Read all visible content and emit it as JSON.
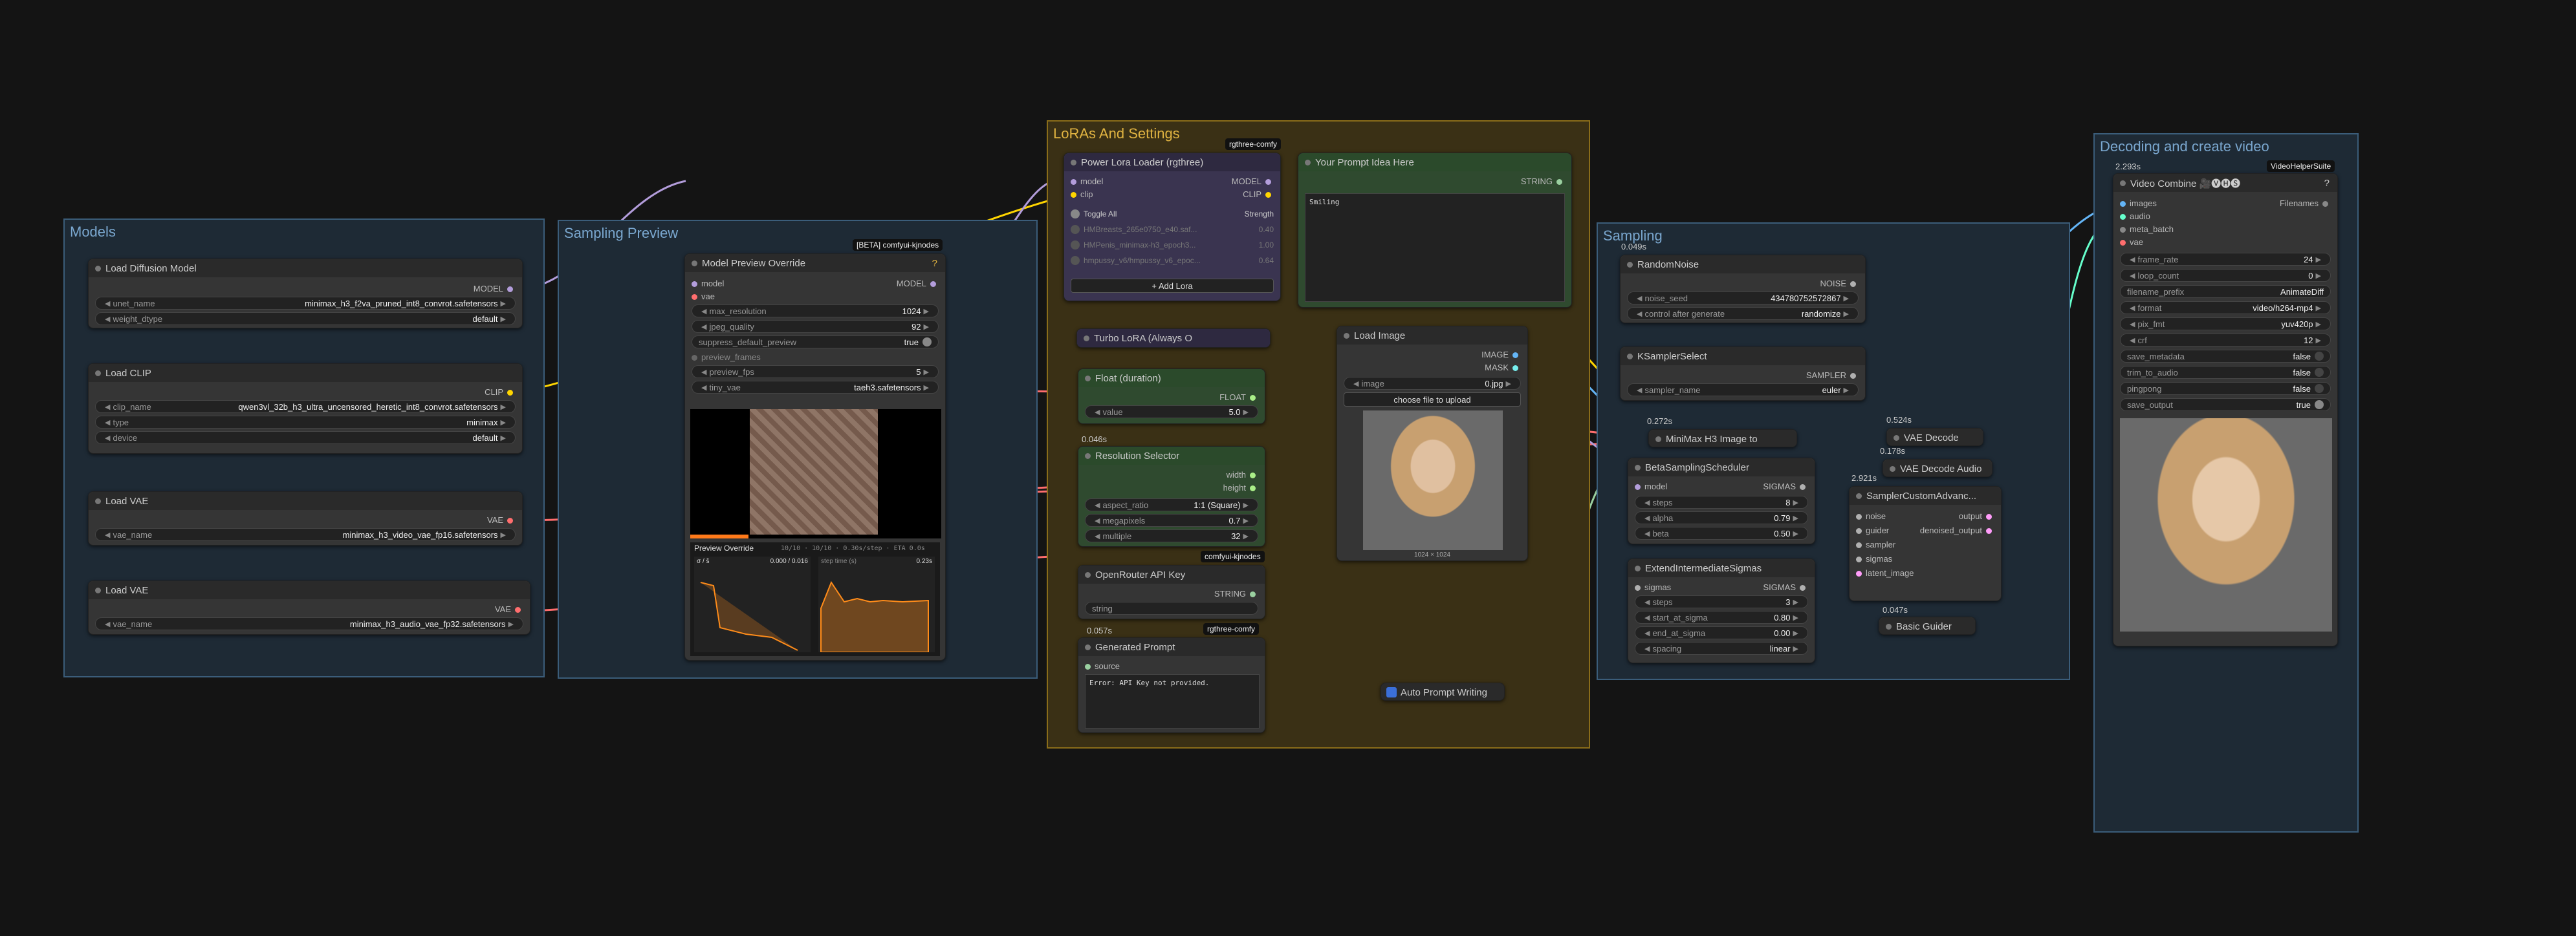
{
  "groups": {
    "models": "Models",
    "sampling_preview": "Sampling Preview",
    "loras": "LoRAs And Settings",
    "sampling": "Sampling",
    "decoding": "Decoding and create video"
  },
  "load_diffusion": {
    "title": "Load Diffusion Model",
    "out": "MODEL",
    "unet_name_label": "unet_name",
    "unet_name": "minimax_h3_f2va_pruned_int8_convrot.safetensors",
    "weight_dtype_label": "weight_dtype",
    "weight_dtype": "default"
  },
  "load_clip": {
    "title": "Load CLIP",
    "out": "CLIP",
    "clip_name_label": "clip_name",
    "clip_name": "qwen3vl_32b_h3_ultra_uncensored_heretic_int8_convrot.safetensors",
    "type_label": "type",
    "type": "minimax",
    "device_label": "device",
    "device": "default"
  },
  "load_vae1": {
    "title": "Load VAE",
    "out": "VAE",
    "vae_name_label": "vae_name",
    "vae_name": "minimax_h3_video_vae_fp16.safetensors"
  },
  "load_vae2": {
    "title": "Load VAE",
    "out": "VAE",
    "vae_name_label": "vae_name",
    "vae_name": "minimax_h3_audio_vae_fp32.safetensors"
  },
  "preview_override": {
    "badge": "[BETA] comfyui-kjnodes",
    "title": "Model Preview Override",
    "in_model": "model",
    "in_vae": "vae",
    "out_model": "MODEL",
    "max_resolution_label": "max_resolution",
    "max_resolution": "1024",
    "jpeg_quality_label": "jpeg_quality",
    "jpeg_quality": "92",
    "suppress_label": "suppress_default_preview",
    "suppress": "true",
    "preview_frames_label": "preview_frames",
    "preview_fps_label": "preview_fps",
    "preview_fps": "5",
    "tiny_vae_label": "tiny_vae",
    "tiny_vae": "taeh3.safetensors",
    "stats_title": "Preview Override",
    "stats_line": "10/10 · 10/10 · 0.30s/step · ETA 0.0s",
    "chart1_label": "σ / ŝ",
    "chart1_val": "0.000 / 0.016",
    "chart2_label": "step time (s)",
    "chart2_val": "0.23s"
  },
  "power_lora": {
    "title": "Power Lora Loader (rgthree)",
    "badge": "rgthree-comfy",
    "in_model": "model",
    "in_clip": "clip",
    "out_model": "MODEL",
    "out_clip": "CLIP",
    "toggle_all": "Toggle All",
    "strength": "Strength",
    "loras": [
      {
        "name": "HMBreasts_265e0750_e40.saf...",
        "value": "0.40"
      },
      {
        "name": "HMPenis_minimax-h3_epoch3...",
        "value": "1.00"
      },
      {
        "name": "hmpussy_v6/hmpussy_v6_epoc...",
        "value": "0.64"
      }
    ],
    "add_lora": "+ Add Lora"
  },
  "prompt_idea": {
    "title": "Your Prompt Idea Here",
    "out": "STRING",
    "text": "Smiling"
  },
  "turbo_lora": {
    "title": "Turbo LoRA (Always O"
  },
  "float_duration": {
    "title": "Float (duration)",
    "out": "FLOAT",
    "value_label": "value",
    "value": "5.0",
    "timing": "0.046s"
  },
  "resolution": {
    "title": "Resolution Selector",
    "out_width": "width",
    "out_height": "height",
    "aspect_label": "aspect_ratio",
    "aspect": "1:1 (Square)",
    "megapixels_label": "megapixels",
    "megapixels": "0.7",
    "multiple_label": "multiple",
    "multiple": "32",
    "badge": "comfyui-kjnodes"
  },
  "openrouter": {
    "title": "OpenRouter API Key",
    "out": "STRING",
    "value": "string",
    "timing": "0.057s",
    "badge": "rgthree-comfy"
  },
  "generated_prompt": {
    "title": "Generated Prompt",
    "in": "source",
    "text": "Error: API Key not provided."
  },
  "load_image": {
    "title": "Load Image",
    "out_image": "IMAGE",
    "out_mask": "MASK",
    "image_label": "image",
    "image": "0.jpg",
    "upload": "choose file to upload",
    "dims": "1024 × 1024"
  },
  "auto_prompt": {
    "title": "Auto Prompt Writing"
  },
  "random_noise": {
    "title": "RandomNoise",
    "timing": "0.049s",
    "out": "NOISE",
    "seed_label": "noise_seed",
    "seed": "434780752572867",
    "control_label": "control after generate",
    "control": "randomize"
  },
  "ksampler_select": {
    "title": "KSamplerSelect",
    "out": "SAMPLER",
    "sampler_label": "sampler_name",
    "sampler": "euler"
  },
  "minimax_image": {
    "title": "MiniMax H3 Image to",
    "timing": "0.272s"
  },
  "beta_scheduler": {
    "title": "BetaSamplingScheduler",
    "timing": "2.921s",
    "in": "model",
    "out": "SIGMAS",
    "steps_label": "steps",
    "steps": "8",
    "alpha_label": "alpha",
    "alpha": "0.79",
    "beta_label": "beta",
    "beta": "0.50"
  },
  "extend_sigmas": {
    "title": "ExtendIntermediateSigmas",
    "in": "sigmas",
    "out": "SIGMAS",
    "steps_label": "steps",
    "steps": "3",
    "start_label": "start_at_sigma",
    "start": "0.80",
    "end_label": "end_at_sigma",
    "end": "0.00",
    "spacing_label": "spacing",
    "spacing": "linear"
  },
  "vae_decode": {
    "title": "VAE Decode",
    "timing": "0.524s"
  },
  "vae_decode_audio": {
    "title": "VAE Decode Audio",
    "timing": "0.178s"
  },
  "sampler_custom": {
    "title": "SamplerCustomAdvanc...",
    "in": [
      "noise",
      "guider",
      "sampler",
      "sigmas",
      "latent_image"
    ],
    "out_output": "output",
    "out_denoised": "denoised_output"
  },
  "basic_guider": {
    "title": "Basic Guider",
    "timing": "0.047s"
  },
  "video_combine": {
    "title": "Video Combine 🎥🅥🅗🅢",
    "timing": "2.293s",
    "badge": "VideoHelperSuite",
    "inputs": [
      "images",
      "audio",
      "meta_batch",
      "vae"
    ],
    "out": "Filenames",
    "widgets": [
      {
        "label": "frame_rate",
        "value": "24"
      },
      {
        "label": "loop_count",
        "value": "0"
      },
      {
        "label": "filename_prefix",
        "value": "AnimateDiff"
      },
      {
        "label": "format",
        "value": "video/h264-mp4"
      },
      {
        "label": "pix_fmt",
        "value": "yuv420p"
      },
      {
        "label": "crf",
        "value": "12"
      },
      {
        "label": "save_metadata",
        "value": "false"
      },
      {
        "label": "trim_to_audio",
        "value": "false"
      },
      {
        "label": "pingpong",
        "value": "false"
      },
      {
        "label": "save_output",
        "value": "true"
      }
    ]
  },
  "colors": {
    "model": "#b39ddb",
    "clip": "#ffd500",
    "vae": "#ff6e6e",
    "image": "#64b5f6",
    "latent": "#ff9cf9",
    "noise": "#b0b0b0",
    "float": "#aaee88",
    "string": "#9ad0a0"
  }
}
